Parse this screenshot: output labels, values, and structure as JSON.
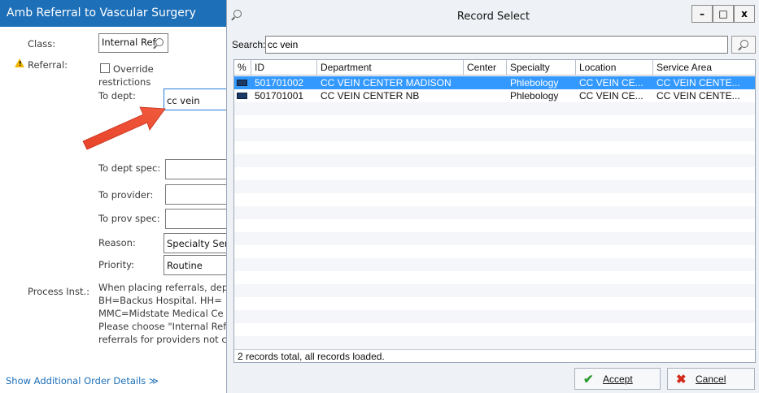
{
  "left_panel": {
    "title": "Amb Referral to Vascular Surgery",
    "class_label": "Class:",
    "class_value": "Internal Ref",
    "referral_label": "Referral:",
    "warning_icon_glyph": "!",
    "override_label": "Override",
    "override_label2": "restrictions",
    "to_dept_label": "To dept:",
    "to_dept_value": "cc vein",
    "to_dept_spec_label": "To dept spec:",
    "to_provider_label": "To provider:",
    "to_prov_spec_label": "To prov spec:",
    "reason_label": "Reason:",
    "reason_value": "Specialty Ser",
    "priority_label": "Priority:",
    "priority_value": "Routine",
    "process_inst_label": "Process Inst.:",
    "process_inst_lines": [
      "When placing referrals, dep",
      "BH=Backus Hospital.  HH=",
      "MMC=Midstate Medical Ce",
      "Please choose \"Internal Ref",
      "referrals for providers not c"
    ],
    "show_more": "Show Additional Order Details ≫"
  },
  "dialog": {
    "title": "Record Select",
    "search_icon": "search-icon",
    "window_buttons": {
      "minimize": "–",
      "maximize": "□",
      "close": "x"
    },
    "search_label": "Search:",
    "search_value": "cc vein",
    "columns": [
      "%",
      "ID",
      "Department",
      "Center",
      "Specialty",
      "Location",
      "Service Area"
    ],
    "rows": [
      {
        "id": "501701002",
        "department": "CC VEIN CENTER MADISON",
        "center": "",
        "specialty": "Phlebology",
        "location": "CC VEIN CE...",
        "service_area": "CC VEIN CENTE...",
        "selected": true
      },
      {
        "id": "501701001",
        "department": "CC VEIN CENTER NB",
        "center": "",
        "specialty": "Phlebology",
        "location": "CC VEIN CE...",
        "service_area": "CC VEIN CENTE...",
        "selected": false
      }
    ],
    "status": "2 records total, all records loaded.",
    "accept_label": "Accept",
    "accept_icon": "✔",
    "cancel_label": "Cancel",
    "cancel_icon": "✖"
  },
  "colors": {
    "title_blue": "#1d6fb8",
    "selection_blue": "#3399ff",
    "arrow_red": "#e8432b",
    "accept_green": "#2e9b2e",
    "cancel_red": "#d42a1a"
  }
}
